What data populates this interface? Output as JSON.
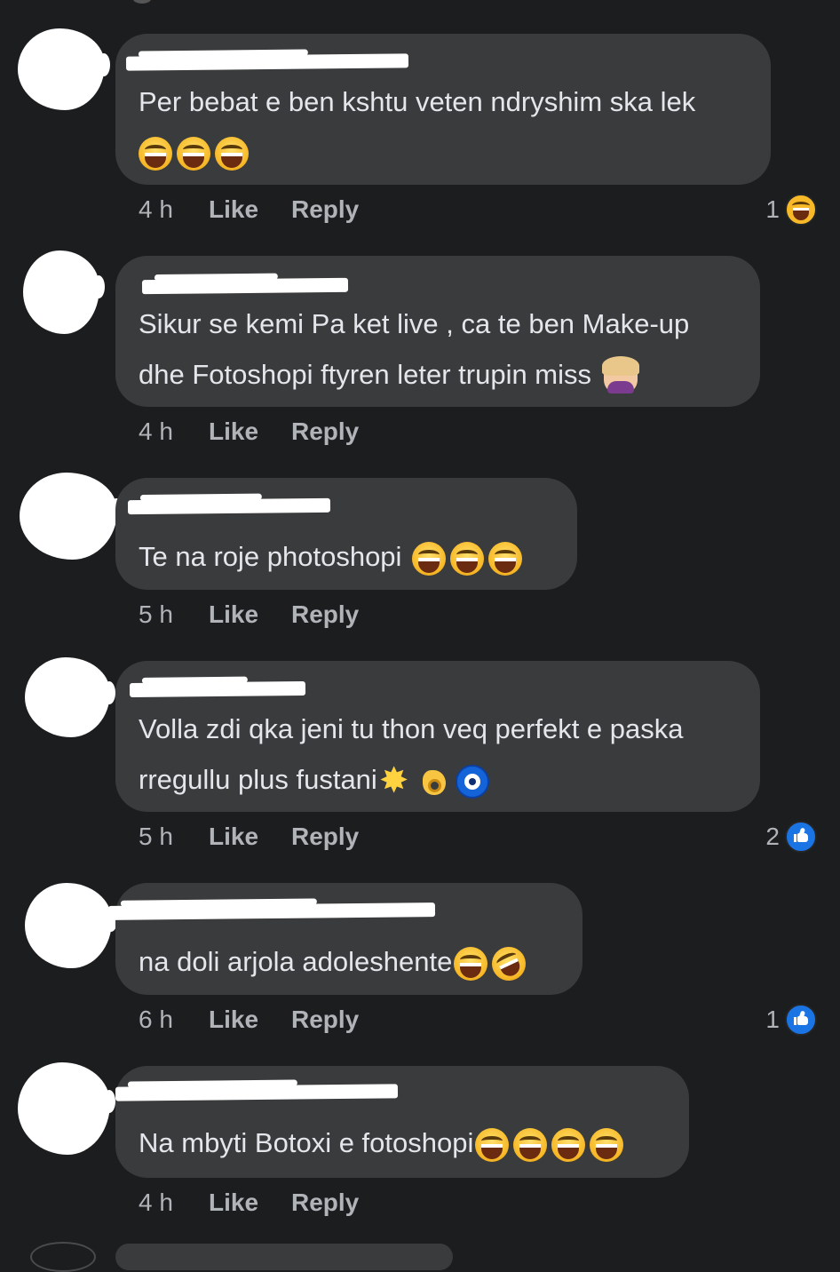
{
  "comments": [
    {
      "text_lines": [
        "Per bebat e ben kshtu veten ndryshim ska lek",
        ""
      ],
      "emojis": [
        "laughing-tears",
        "laughing-tears",
        "laughing-tears"
      ],
      "time": "4 h",
      "like": "Like",
      "reply": "Reply",
      "reaction_count": "1",
      "reaction_icon": "haha-icon"
    },
    {
      "text_lines": [
        "Sikur se kemi Pa ket live , ca te ben Make-up",
        "dhe Fotoshopi ftyren leter trupin miss"
      ],
      "emojis": [
        "facepalm"
      ],
      "time": "4 h",
      "like": "Like",
      "reply": "Reply"
    },
    {
      "text_lines": [
        "Te na roje photoshopi"
      ],
      "emojis": [
        "laughing-tears",
        "laughing-tears",
        "laughing-tears"
      ],
      "time": "5 h",
      "like": "Like",
      "reply": "Reply"
    },
    {
      "text_lines": [
        "Volla zdi qka jeni tu thon veq perfekt e paska",
        "rregullu plus fustani"
      ],
      "emojis": [
        "sparkle-star",
        "ok-hand",
        "nazar-amulet"
      ],
      "time": "5 h",
      "like": "Like",
      "reply": "Reply",
      "reaction_count": "2",
      "reaction_icon": "like-icon"
    },
    {
      "text_lines": [
        "na doli arjola adoleshente"
      ],
      "emojis": [
        "laughing-tears",
        "rolling-laughing"
      ],
      "time": "6 h",
      "like": "Like",
      "reply": "Reply",
      "reaction_count": "1",
      "reaction_icon": "like-icon"
    },
    {
      "text_lines": [
        "Na mbyti Botoxi e fotoshopi"
      ],
      "emojis": [
        "laughing-tears",
        "laughing-tears",
        "laughing-tears",
        "laughing-tears"
      ],
      "time": "4 h",
      "like": "Like",
      "reply": "Reply"
    }
  ],
  "colors": {
    "background": "#1c1d1f",
    "bubble": "#3a3b3c",
    "text": "#e4e6eb",
    "meta": "#b0b3b8",
    "like_blue": "#1b74e4",
    "haha_yellow": "#f7b928"
  }
}
